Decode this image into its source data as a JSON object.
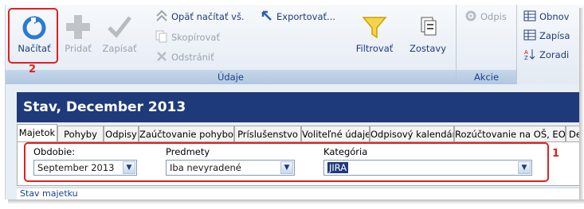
{
  "ribbon": {
    "udaje_group": {
      "label": "Údaje",
      "load_button": "Načítať",
      "add_button": "Pridať",
      "save_button": "Zapísať",
      "reload_all": "Opäť načítať vš.",
      "export": "Exportovať...",
      "copy": "Skopírovať",
      "remove": "Odstrániť",
      "filter_button": "Filtrovať",
      "reports_button": "Zostavy"
    },
    "akcie_group": {
      "label": "Akcie",
      "writeoff_button": "Odpis"
    },
    "right_group": {
      "item1": "Obnov",
      "item2": "Zapísa",
      "item3": "Zoradi"
    }
  },
  "annotations": {
    "one": "1",
    "two": "2"
  },
  "title": "Stav, December 2013",
  "tabs": [
    {
      "label": "Majetok",
      "active": true
    },
    {
      "label": "Pohyby"
    },
    {
      "label": "Odpisy"
    },
    {
      "label": "Zaúčtovanie pohybov"
    },
    {
      "label": "Príslušenstvo"
    },
    {
      "label": "Voliteľné údaje"
    },
    {
      "label": "Odpisový kalendár"
    },
    {
      "label": "Rozúčtovanie na OŠ, EO"
    },
    {
      "label": "De"
    }
  ],
  "filters": {
    "period": {
      "label": "Obdobie:",
      "value": "September 2013"
    },
    "items": {
      "label": "Predmety",
      "value": "Iba nevyradené"
    },
    "category": {
      "label": "Kategória",
      "value": "JIRA"
    }
  },
  "status": "Stav majetku",
  "colors": {
    "accent": "#1f3a7a",
    "annotation": "#e02020",
    "ribbon_text": "#1e3d7a"
  }
}
